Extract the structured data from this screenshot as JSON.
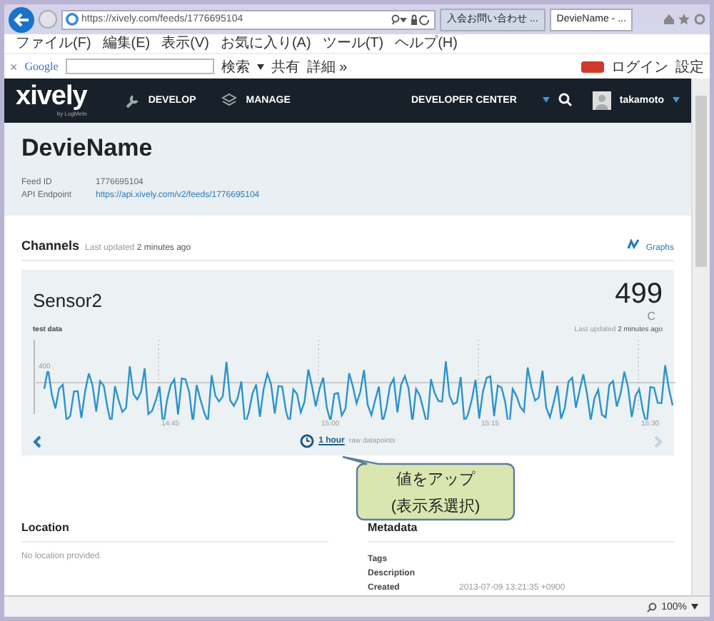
{
  "browser": {
    "address": "https://xively.com/feeds/1776695104",
    "tabs": [
      {
        "label": "入会お問い合わせ ...",
        "selected": false
      },
      {
        "label": "DevieName - ...",
        "selected": true
      }
    ],
    "menu": [
      "ファイル(F)",
      "編集(E)",
      "表示(V)",
      "お気に入り(A)",
      "ツール(T)",
      "ヘルプ(H)"
    ],
    "toolbar": {
      "close": "×",
      "brand": "Google",
      "search": "検索",
      "share": "共有",
      "more": "詳細 »",
      "login": "ログイン",
      "settings": "設定"
    }
  },
  "nav": {
    "logo": "xively",
    "logo_sub": "by LogMeIn",
    "items": [
      "DEVELOP",
      "MANAGE"
    ],
    "center": "DEVELOPER CENTER",
    "user": "takamoto"
  },
  "device": {
    "name": "DevieName",
    "fields": [
      {
        "label": "Feed ID",
        "value": "1776695104",
        "kind": "text"
      },
      {
        "label": "API Endpoint",
        "value": "https://api.xively.com/v2/feeds/1776695104",
        "kind": "link"
      }
    ]
  },
  "channels": {
    "title": "Channels",
    "updated_label": "Last updated",
    "updated": "2 minutes ago",
    "graphs": "Graphs"
  },
  "sensor": {
    "name": "Sensor2",
    "value": "499",
    "unit": "C",
    "tag": "test data",
    "updated_label": "Last updated",
    "updated": "2 minutes ago",
    "y_label": "400",
    "x_labels": [
      "14:45",
      "15:00",
      "15:15",
      "15:30"
    ],
    "range": "1 hour",
    "range_note": "raw datapoints"
  },
  "callout": {
    "lines": [
      "値をアップ",
      "(表示系選択)"
    ]
  },
  "location": {
    "title": "Location",
    "text": "No location provided."
  },
  "metadata": {
    "title": "Metadata",
    "rows": [
      {
        "label": "Tags"
      },
      {
        "label": "Description"
      },
      {
        "label": "Created",
        "value": "2013-07-09 13:21:35 +0900"
      }
    ]
  },
  "status": {
    "zoom": "100%"
  }
}
